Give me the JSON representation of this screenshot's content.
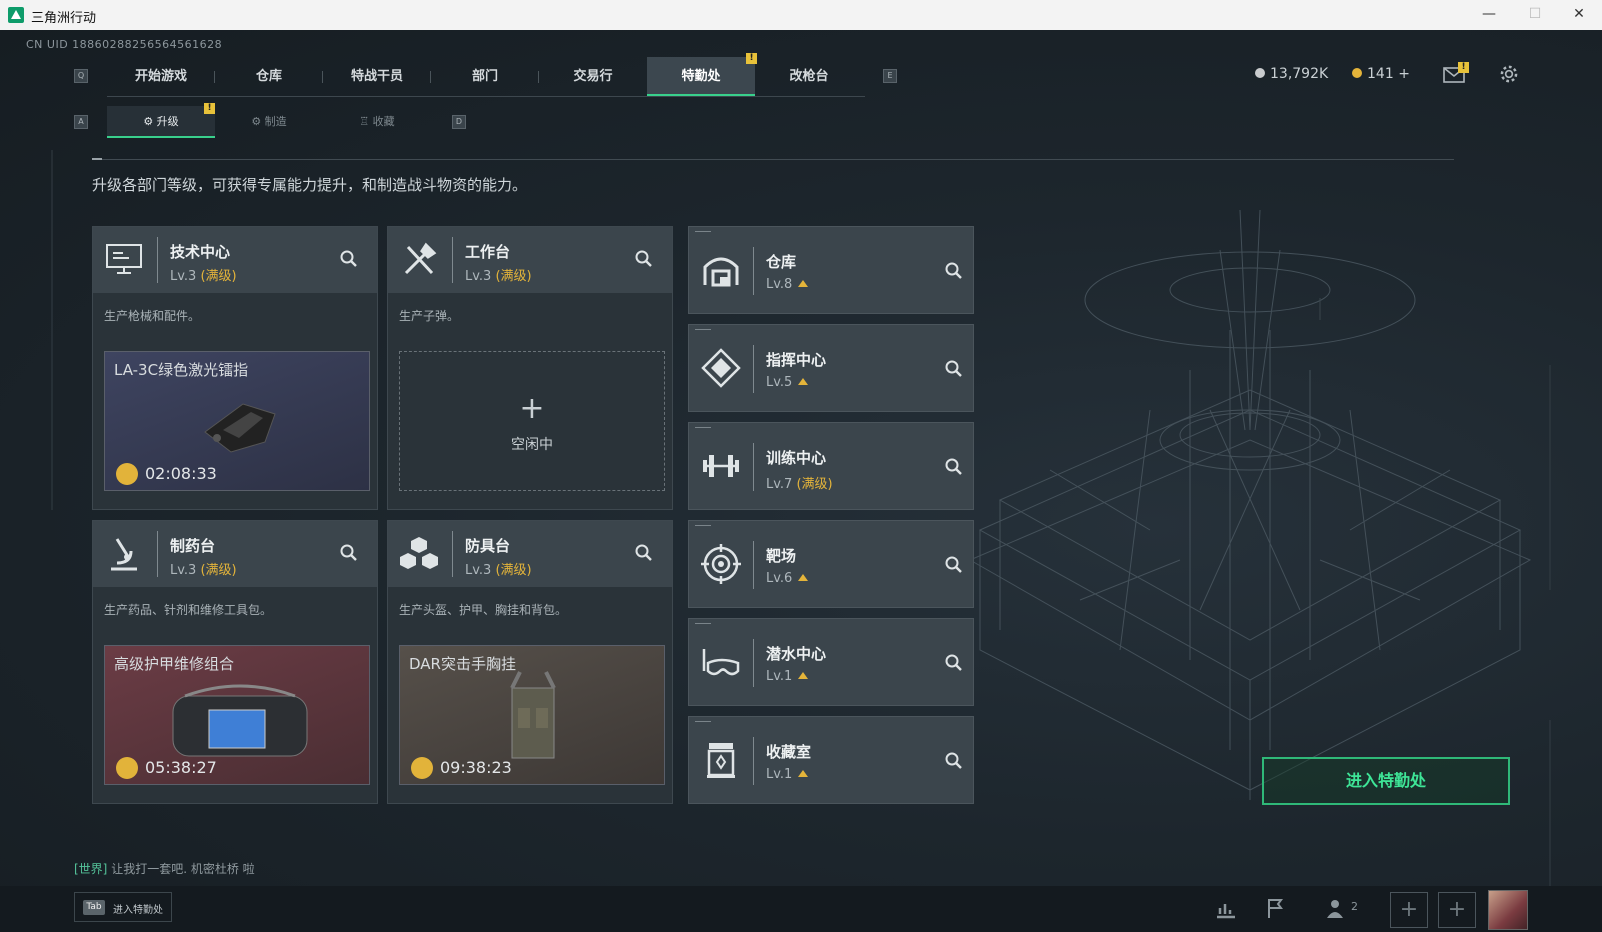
{
  "window": {
    "title": "三角洲行动",
    "controls": [
      "—",
      "☐",
      "✕"
    ]
  },
  "uid": "CN UID 18860288256564561628",
  "nav": {
    "left_key": "Q",
    "right_key": "E",
    "tabs": [
      "开始游戏",
      "仓库",
      "特战干员",
      "部门",
      "交易行",
      "特勤处",
      "改枪台"
    ],
    "active": "特勤处",
    "badge": "!"
  },
  "currency": {
    "silver": "13,792K",
    "gold": "141",
    "gold_add": "+",
    "silver_color": "#c9ccce",
    "gold_color": "#e4b43a"
  },
  "mail_badge": "!",
  "subnav": {
    "left_key": "A",
    "right_key": "D",
    "tabs": [
      "升级",
      "制造",
      "收藏"
    ],
    "active": "升级",
    "badge": "!"
  },
  "description": "升级各部门等级，可获得专属能力提升，和制造战斗物资的能力。",
  "workstations": [
    {
      "name": "技术中心",
      "level": "Lv.3",
      "max": "(满级)",
      "desc": "生产枪械和配件。",
      "icon": "computer-icon",
      "product": "LA-3C绿色激光镭指",
      "timer": "02:08:33",
      "bg": "#3a3f55"
    },
    {
      "name": "工作台",
      "level": "Lv.3",
      "max": "(满级)",
      "desc": "生产子弹。",
      "icon": "tools-icon",
      "idle": "空闲中"
    },
    {
      "name": "制药台",
      "level": "Lv.3",
      "max": "(满级)",
      "desc": "生产药品、针剂和维修工具包。",
      "icon": "microscope-icon",
      "product": "高级护甲维修组合",
      "timer": "05:38:27",
      "bg": "#5a3a40"
    },
    {
      "name": "防具台",
      "level": "Lv.3",
      "max": "(满级)",
      "desc": "生产头盔、护甲、胸挂和背包。",
      "icon": "armor-icon",
      "product": "DAR突击手胸挂",
      "timer": "09:38:23",
      "bg": "#4a4440"
    }
  ],
  "facilities": [
    {
      "name": "仓库",
      "level": "Lv.8",
      "icon": "warehouse-icon"
    },
    {
      "name": "指挥中心",
      "level": "Lv.5",
      "icon": "command-icon"
    },
    {
      "name": "训练中心",
      "level": "Lv.7",
      "max": "(满级)",
      "icon": "dumbbell-icon"
    },
    {
      "name": "靶场",
      "level": "Lv.6",
      "icon": "target-icon"
    },
    {
      "name": "潜水中心",
      "level": "Lv.1",
      "icon": "diving-mask-icon"
    },
    {
      "name": "收藏室",
      "level": "Lv.1",
      "icon": "collection-icon"
    }
  ],
  "enter_button": "进入特勤处",
  "chat": {
    "channel": "[世界]",
    "message": "让我打一套吧. 机密杜桥 啦"
  },
  "bottom": {
    "tab_key": "Tab",
    "tab_label": "进入特勤处",
    "friends_count": "2",
    "plus": "+"
  },
  "accent": "#39d08c"
}
